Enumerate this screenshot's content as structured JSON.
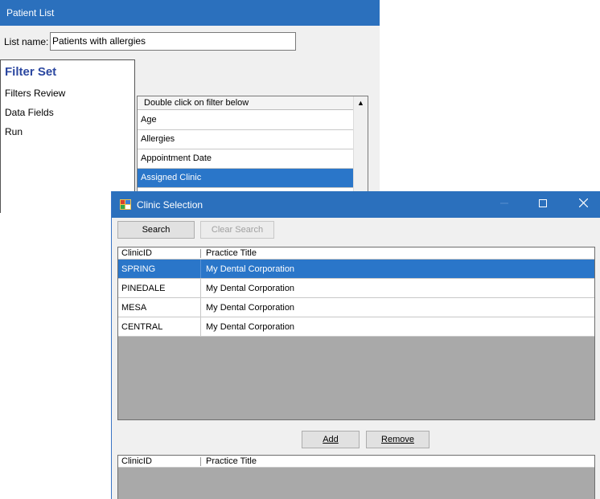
{
  "patient_list": {
    "title": "Patient List",
    "list_name_label": "List name:",
    "list_name_value": "Patients with allergies",
    "filter_set_title": "Filter Set",
    "nav": [
      "Filters Review",
      "Data Fields",
      "Run"
    ],
    "filter_header": "Double click on filter below",
    "filters": [
      "Age",
      "Allergies",
      "Appointment Date",
      "Assigned Clinic"
    ],
    "selected_filter": "Assigned Clinic"
  },
  "clinic_selection": {
    "title": "Clinic Selection",
    "search_label": "Search",
    "clear_search_label": "Clear Search",
    "add_label": "Add",
    "remove_label": "Remove",
    "columns": [
      "ClinicID",
      "Practice Title"
    ],
    "clinics": [
      {
        "id": "SPRING",
        "title": "My Dental Corporation"
      },
      {
        "id": "PINEDALE",
        "title": "My Dental Corporation"
      },
      {
        "id": "MESA",
        "title": "My Dental Corporation"
      },
      {
        "id": "CENTRAL",
        "title": "My Dental Corporation"
      }
    ],
    "selected_clinic": "SPRING",
    "selected_columns": [
      "ClinicID",
      "Practice Title"
    ]
  },
  "colors": {
    "titlebar": "#2b70bd",
    "selection": "#2a76c9",
    "filter_set_title": "#2b47a0",
    "grid_empty": "#a9a9a9"
  }
}
